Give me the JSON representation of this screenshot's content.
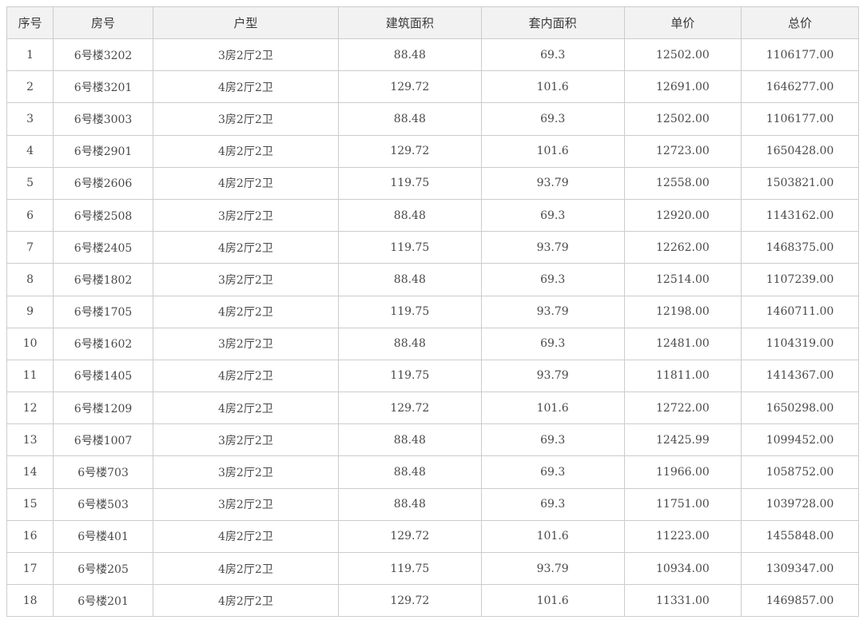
{
  "table": {
    "headers": [
      "序号",
      "房号",
      "户型",
      "建筑面积",
      "套内面积",
      "单价",
      "总价"
    ],
    "rows": [
      [
        "1",
        "6号楼3202",
        "3房2厅2卫",
        "88.48",
        "69.3",
        "12502.00",
        "1106177.00"
      ],
      [
        "2",
        "6号楼3201",
        "4房2厅2卫",
        "129.72",
        "101.6",
        "12691.00",
        "1646277.00"
      ],
      [
        "3",
        "6号楼3003",
        "3房2厅2卫",
        "88.48",
        "69.3",
        "12502.00",
        "1106177.00"
      ],
      [
        "4",
        "6号楼2901",
        "4房2厅2卫",
        "129.72",
        "101.6",
        "12723.00",
        "1650428.00"
      ],
      [
        "5",
        "6号楼2606",
        "4房2厅2卫",
        "119.75",
        "93.79",
        "12558.00",
        "1503821.00"
      ],
      [
        "6",
        "6号楼2508",
        "3房2厅2卫",
        "88.48",
        "69.3",
        "12920.00",
        "1143162.00"
      ],
      [
        "7",
        "6号楼2405",
        "4房2厅2卫",
        "119.75",
        "93.79",
        "12262.00",
        "1468375.00"
      ],
      [
        "8",
        "6号楼1802",
        "3房2厅2卫",
        "88.48",
        "69.3",
        "12514.00",
        "1107239.00"
      ],
      [
        "9",
        "6号楼1705",
        "4房2厅2卫",
        "119.75",
        "93.79",
        "12198.00",
        "1460711.00"
      ],
      [
        "10",
        "6号楼1602",
        "3房2厅2卫",
        "88.48",
        "69.3",
        "12481.00",
        "1104319.00"
      ],
      [
        "11",
        "6号楼1405",
        "4房2厅2卫",
        "119.75",
        "93.79",
        "11811.00",
        "1414367.00"
      ],
      [
        "12",
        "6号楼1209",
        "4房2厅2卫",
        "129.72",
        "101.6",
        "12722.00",
        "1650298.00"
      ],
      [
        "13",
        "6号楼1007",
        "3房2厅2卫",
        "88.48",
        "69.3",
        "12425.99",
        "1099452.00"
      ],
      [
        "14",
        "6号楼703",
        "3房2厅2卫",
        "88.48",
        "69.3",
        "11966.00",
        "1058752.00"
      ],
      [
        "15",
        "6号楼503",
        "3房2厅2卫",
        "88.48",
        "69.3",
        "11751.00",
        "1039728.00"
      ],
      [
        "16",
        "6号楼401",
        "4房2厅2卫",
        "129.72",
        "101.6",
        "11223.00",
        "1455848.00"
      ],
      [
        "17",
        "6号楼205",
        "4房2厅2卫",
        "119.75",
        "93.79",
        "10934.00",
        "1309347.00"
      ],
      [
        "18",
        "6号楼201",
        "4房2厅2卫",
        "129.72",
        "101.6",
        "11331.00",
        "1469857.00"
      ]
    ]
  }
}
